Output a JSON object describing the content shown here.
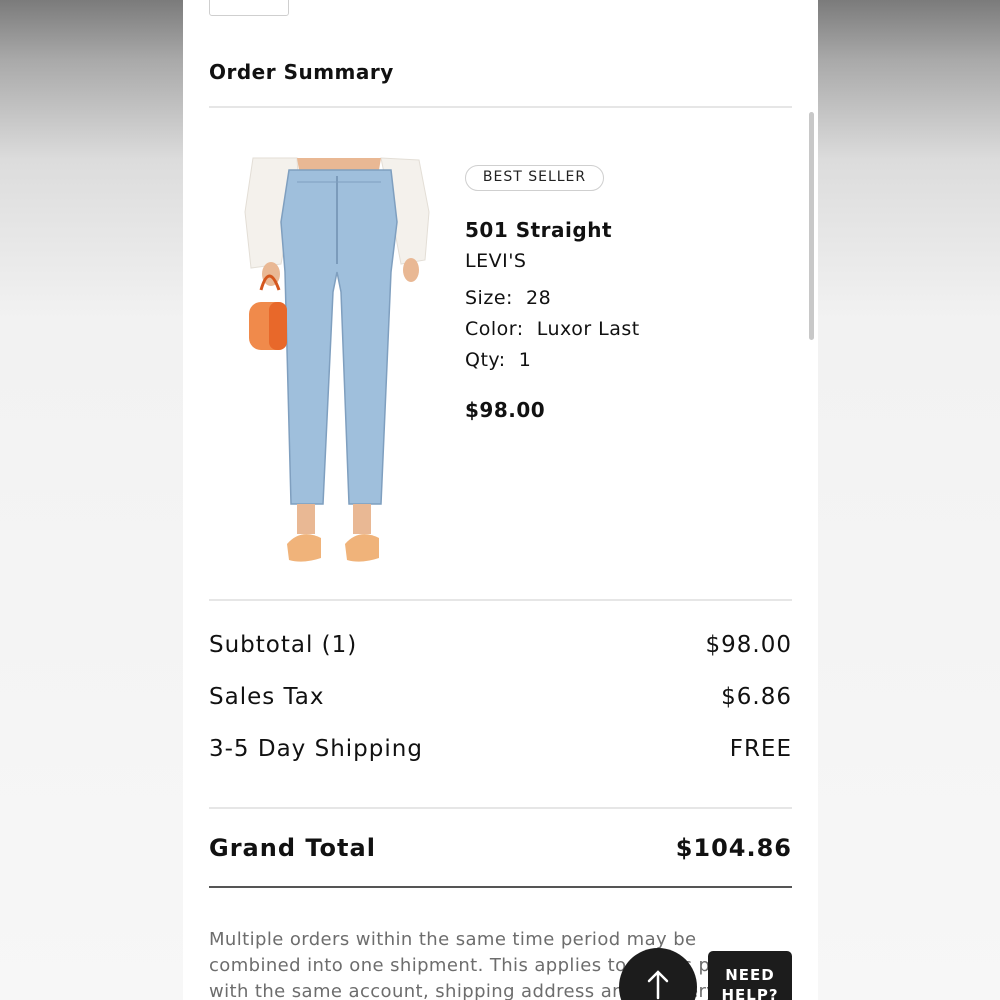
{
  "order_summary": {
    "title": "Order Summary"
  },
  "product": {
    "badge": "BEST SELLER",
    "name": "501 Straight",
    "brand": "LEVI'S",
    "size_text": "Size:  28",
    "color_text": "Color:  Luxor Last",
    "qty_text": "Qty:  1",
    "price": "$98.00",
    "image_icon": "jeans-photo"
  },
  "totals": {
    "subtotal_label": "Subtotal (1)",
    "subtotal_value": "$98.00",
    "tax_label": "Sales Tax",
    "tax_value": "$6.86",
    "shipping_label": "3-5 Day Shipping",
    "shipping_value": "FREE",
    "grand_label": "Grand Total",
    "grand_value": "$104.86"
  },
  "note": {
    "text": "Multiple orders within the same time period may be combined into one shipment. This applies to orders placed with the same account, shipping address and delivery method."
  },
  "floating": {
    "scroll_top_icon": "arrow-up-icon",
    "need_help_line1": "NEED",
    "need_help_line2": "HELP?"
  },
  "colors": {
    "text": "#111111",
    "muted": "#6d6d6d",
    "button_dark": "#1c1c1c",
    "divider": "#e6e6e6"
  }
}
